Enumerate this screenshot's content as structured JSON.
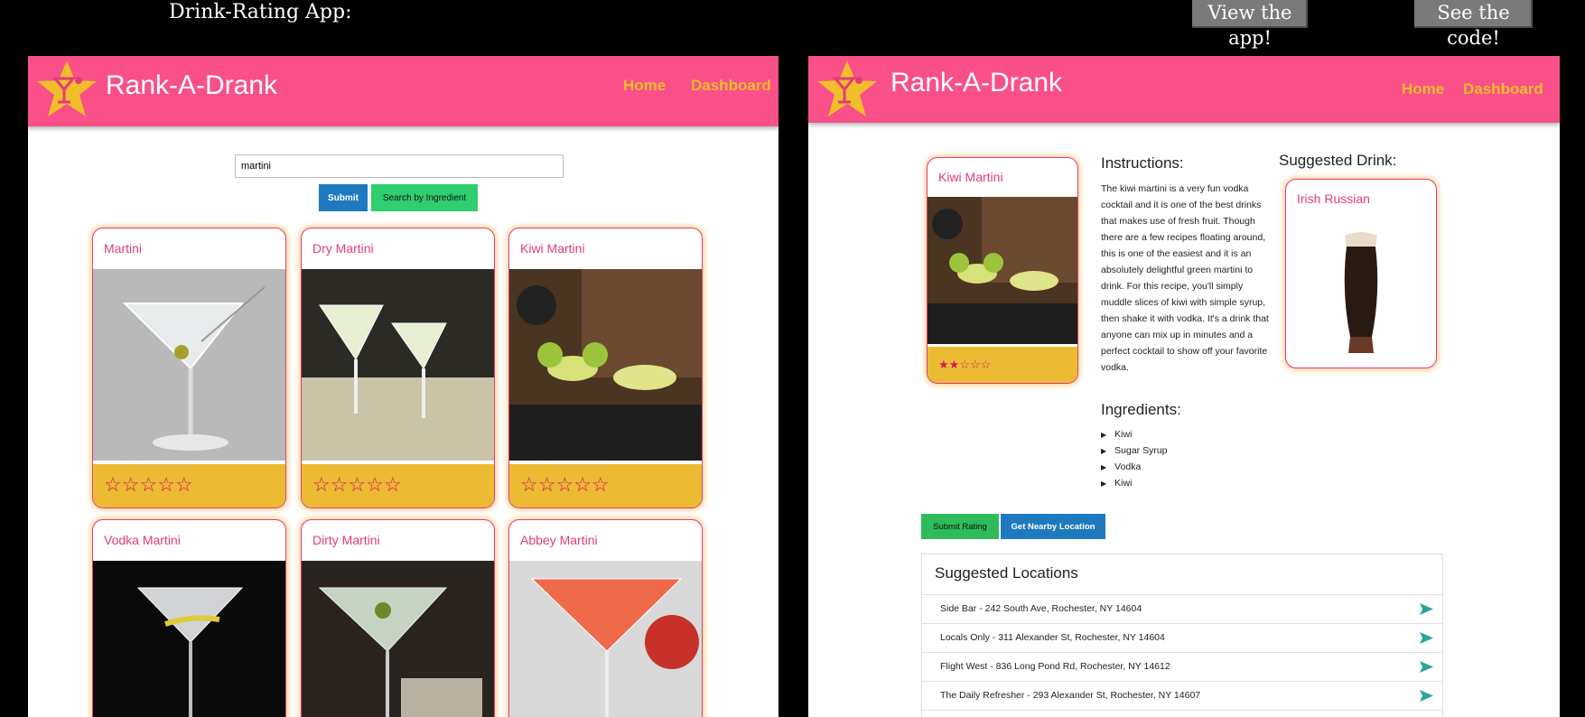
{
  "header": {
    "title": "Drink-Rating App:",
    "view_app": "View the app!",
    "see_code": "See the code!"
  },
  "left": {
    "brand": "Rank-A-Drank",
    "nav": {
      "home": "Home",
      "dashboard": "Dashboard"
    },
    "search": {
      "value": "martini"
    },
    "submit_label": "Submit",
    "ingredient_label": "Search by Ingredient",
    "cards": [
      {
        "name": "Martini",
        "stars": "☆☆☆☆☆"
      },
      {
        "name": "Dry Martini",
        "stars": "☆☆☆☆☆"
      },
      {
        "name": "Kiwi Martini",
        "stars": "☆☆☆☆☆"
      },
      {
        "name": "Vodka Martini"
      },
      {
        "name": "Dirty Martini"
      },
      {
        "name": "Abbey Martini"
      }
    ]
  },
  "right": {
    "brand": "Rank-A-Drank",
    "nav": {
      "home": "Home",
      "dashboard": "Dashboard"
    },
    "drink": {
      "name": "Kiwi Martini",
      "stars": "★★☆☆☆",
      "rating": 2,
      "max_rating": 5
    },
    "instructions_heading": "Instructions:",
    "instructions": "The kiwi martini is a very fun vodka cocktail and it is one of the best drinks that makes use of fresh fruit. Though there are a few recipes floating around, this is one of the easiest and it is an absolutely delightful green martini to drink. For this recipe, you'll simply muddle slices of kiwi with simple syrup, then shake it with vodka. It's a drink that anyone can mix up in minutes and a perfect cocktail to show off your favorite vodka.",
    "ingredients_heading": "Ingredients:",
    "ingredients": [
      "Kiwi",
      "Sugar Syrup",
      "Vodka",
      "Kiwi"
    ],
    "suggested_heading": "Suggested Drink:",
    "suggested_drink": "Irish Russian",
    "submit_rating": "Submit Rating",
    "nearby": "Get Nearby Location",
    "locations_heading": "Suggested Locations",
    "locations": [
      "Side Bar - 242 South Ave, Rochester, NY 14604",
      "Locals Only - 311 Alexander St, Rochester, NY 14604",
      "Flight West - 836 Long Pond Rd, Rochester, NY 14612",
      "The Daily Refresher - 293 Alexander St, Rochester, NY 14607"
    ]
  },
  "colors": {
    "nav_pink": "#f95089",
    "accent_gold": "#f2bd2b",
    "card_footer": "#ecbb33",
    "blue_button": "#1f79be",
    "green_button": "#2fce6e",
    "send_icon": "#2aa59a"
  }
}
